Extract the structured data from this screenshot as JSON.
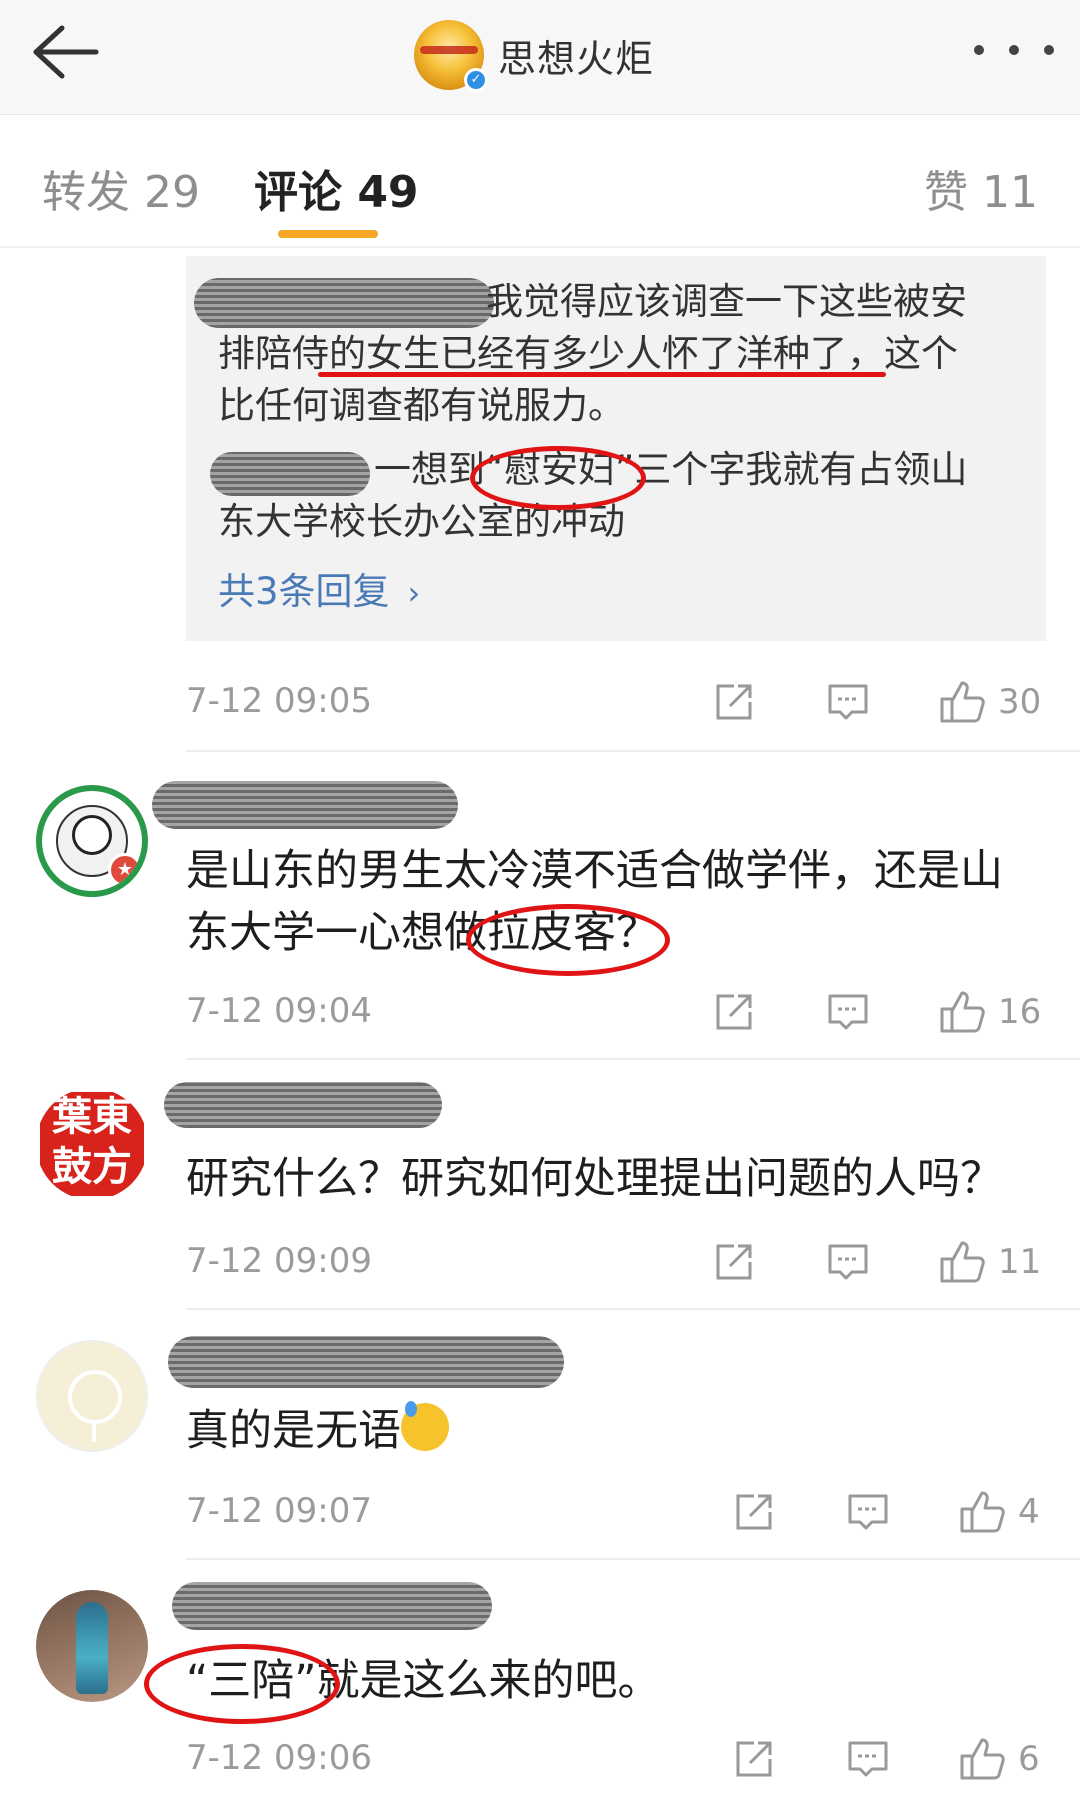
{
  "header": {
    "back_icon": "back-arrow-icon",
    "title": "思想火炬",
    "verified_icon": "verified-badge-icon",
    "more_icon": "more-dots-icon"
  },
  "tabs": [
    {
      "label": "转发 29",
      "active": false
    },
    {
      "label": "评论 49",
      "active": true
    },
    {
      "label": "赞 11",
      "active": false
    }
  ],
  "colors": {
    "accent_underline": "#f5a623",
    "link_blue": "#4a7ab5",
    "annotation_red": "#e01414"
  },
  "reply_box": {
    "reply1_line1": "我觉得应该调查一下这些被安",
    "reply1_line2": "排陪侍的女生已经有多少人怀了洋种了，这个",
    "reply1_line3": "比任何调查都有说服力。",
    "reply2_line1": "一想到“慰安妇”三个字我就有占领山",
    "reply2_line2": "东大学校长办公室的冲动",
    "more_replies": "共3条回复",
    "chevron_icon": "chevron-right-icon"
  },
  "comments": [
    {
      "text_lines": [],
      "time": "7-12 09:05",
      "likes": "30"
    },
    {
      "text_lines": [
        "是山东的男生太冷漠不适合做学伴，还是山",
        "东大学一心想做拉皮客？"
      ],
      "time": "7-12 09:04",
      "likes": "16"
    },
    {
      "text_lines": [
        "研究什么？研究如何处理提出问题的人吗？"
      ],
      "avatar_text": "葉東 鼓方",
      "time": "7-12 09:09",
      "likes": "11"
    },
    {
      "text_lines": [
        "真的是无语"
      ],
      "time": "7-12 09:07",
      "likes": "4"
    },
    {
      "text_lines": [
        "“三陪”就是这么来的吧。"
      ],
      "time": "7-12 09:06",
      "likes": "6"
    }
  ],
  "icons": {
    "share": "share-icon",
    "comment": "comment-icon",
    "like": "thumbs-up-icon"
  }
}
